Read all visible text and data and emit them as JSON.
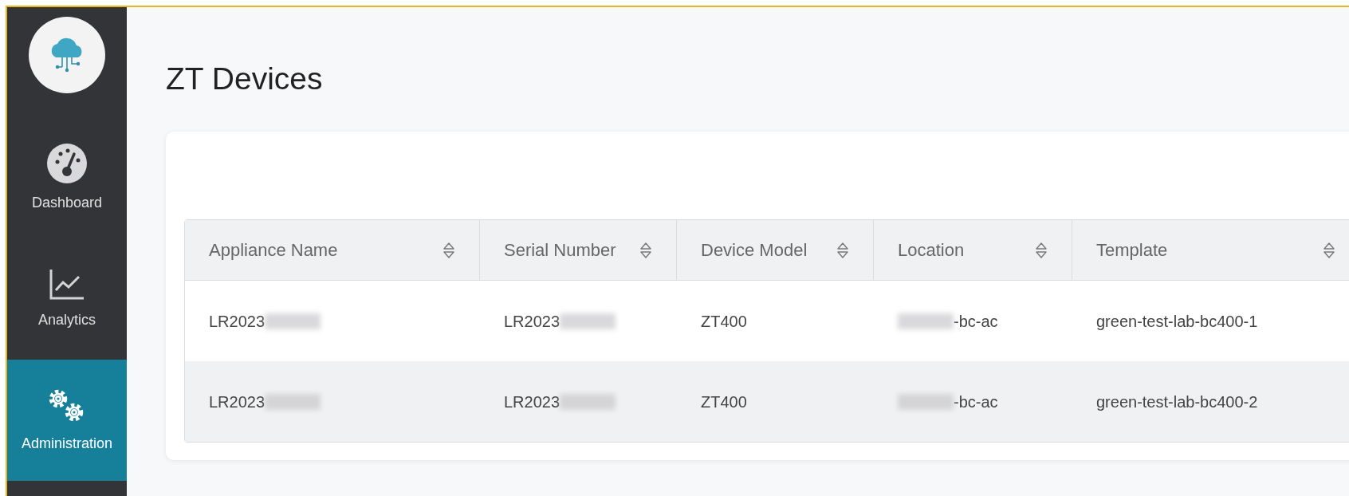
{
  "sidebar": {
    "items": [
      {
        "label": "Dashboard",
        "selected": false
      },
      {
        "label": "Analytics",
        "selected": false
      },
      {
        "label": "Administration",
        "selected": true
      }
    ]
  },
  "page": {
    "title": "ZT Devices"
  },
  "table": {
    "columns": [
      "Appliance Name",
      "Serial Number",
      "Device Model",
      "Location",
      "Template"
    ],
    "rows": [
      [
        {
          "text": "LR2023",
          "kind": "blurtail"
        },
        {
          "text": "LR2023",
          "kind": "blurtail"
        },
        {
          "text": "ZT400",
          "kind": "plain"
        },
        {
          "text": "-bc-ac",
          "kind": "blurhead"
        },
        {
          "text": "green-test-lab-bc400-1",
          "kind": "plain"
        }
      ],
      [
        {
          "text": "LR2023",
          "kind": "blurtail"
        },
        {
          "text": "LR2023",
          "kind": "blurtail"
        },
        {
          "text": "ZT400",
          "kind": "plain"
        },
        {
          "text": "-bc-ac",
          "kind": "blurhead"
        },
        {
          "text": "green-test-lab-bc400-2",
          "kind": "plain"
        }
      ]
    ]
  }
}
